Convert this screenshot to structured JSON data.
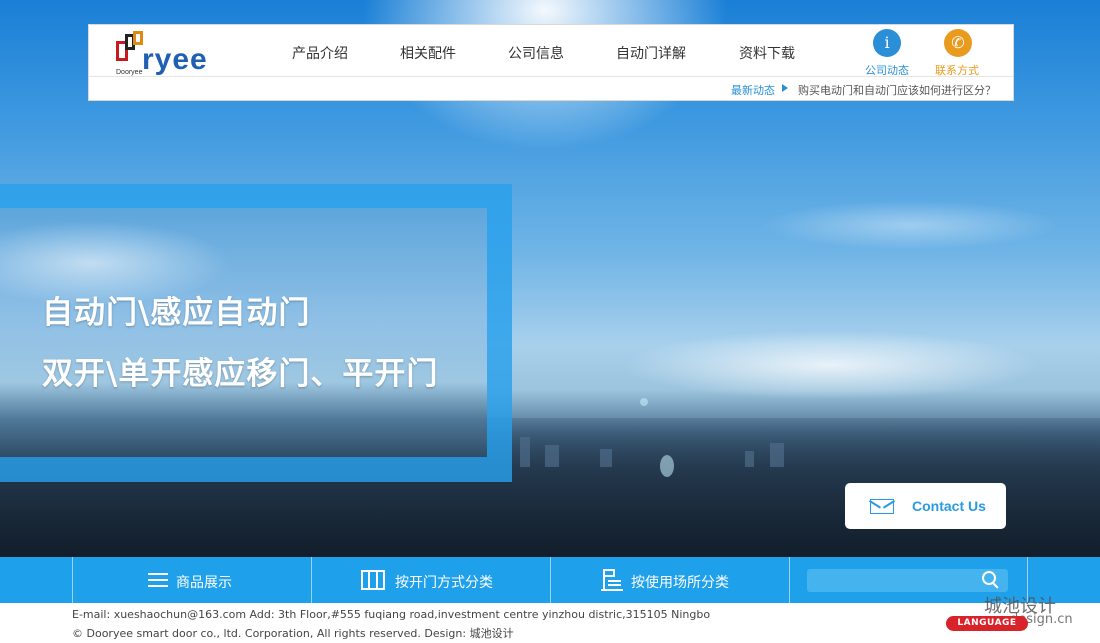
{
  "header": {
    "logo_text": "ryee",
    "logo_small": "Dooryee",
    "nav": [
      {
        "label": "产品介绍"
      },
      {
        "label": "相关配件"
      },
      {
        "label": "公司信息"
      },
      {
        "label": "自动门详解"
      },
      {
        "label": "资料下载"
      }
    ],
    "company_news": {
      "label": "公司动态",
      "icon": "info-icon",
      "color": "#2a8fd6"
    },
    "contact": {
      "label": "联系方式",
      "icon": "phone-icon",
      "color": "#e89b1c"
    },
    "news_ticker": {
      "label": "最新动态",
      "text": "购买电动门和自动门应该如何进行区分？"
    }
  },
  "hero": {
    "line1": "自动门\\感应自动门",
    "line2": "双开\\单开感应移门、平开门"
  },
  "contact_button": {
    "label": "Contact Us",
    "icon": "mail-icon"
  },
  "bottom_bar": {
    "items": [
      {
        "label": "商品展示",
        "icon": "list-icon"
      },
      {
        "label": "按开门方式分类",
        "icon": "door-icon"
      },
      {
        "label": "按使用场所分类",
        "icon": "building-icon"
      }
    ],
    "search": {
      "placeholder": "",
      "icon": "search-icon"
    }
  },
  "footer": {
    "line1": "E-mail: xueshaochun@163.com     Add: 3th Floor,#555 fuqiang road,investment centre yinzhou distric,315105 Ningbo",
    "line2": "© Dooryee smart door co., ltd. Corporation, All rights reserved.    Design: 城池设计",
    "language_button": "LANGUAGE",
    "watermark_cn": "城池设计",
    "watermark_url": "design.cn"
  },
  "colors": {
    "accent": "#1ea0ea",
    "brand_blue": "#1f5fb4",
    "brand_red": "#c8191f"
  }
}
